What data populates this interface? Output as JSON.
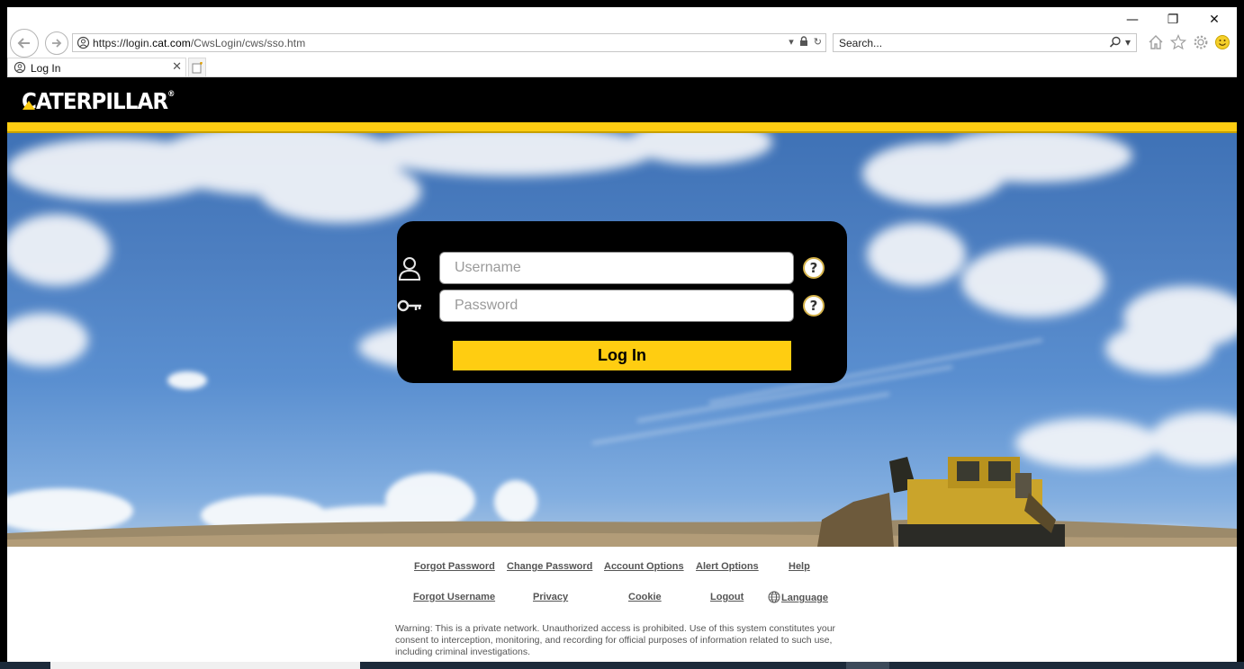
{
  "browser": {
    "url_prefix": "https://login.",
    "url_host": "cat.com",
    "url_path": "/CwsLogin/cws/sso.htm",
    "search_placeholder": "Search...",
    "tab_title": "Log In",
    "window_controls": {
      "minimize": "—",
      "restore": "❐",
      "close": "✕"
    }
  },
  "header": {
    "brand": "CATERPILLAR",
    "brand_mark": "®"
  },
  "login": {
    "username_placeholder": "Username",
    "password_placeholder": "Password",
    "help_label": "?",
    "submit_label": "Log In"
  },
  "footer": {
    "links_row1": [
      "Forgot Password",
      "Change Password",
      "Account Options",
      "Alert Options",
      "Help"
    ],
    "links_row2": [
      "Forgot Username",
      "Privacy",
      "Cookie",
      "Logout",
      "Language"
    ],
    "warning": "Warning: This is a private network. Unauthorized access is prohibited. Use of this system constitutes your consent to interception, monitoring, and recording for official purposes of information related to such use, including criminal investigations."
  },
  "colors": {
    "cat_yellow": "#ffcd11",
    "header_black": "#000000",
    "sky_blue": "#4d7fc1"
  },
  "icons": [
    "back-icon",
    "forward-icon",
    "lock-icon",
    "refresh-icon",
    "search-icon",
    "home-icon",
    "favorites-star-icon",
    "gear-icon",
    "smiley-icon",
    "user-icon",
    "key-icon",
    "help-icon",
    "globe-icon"
  ]
}
